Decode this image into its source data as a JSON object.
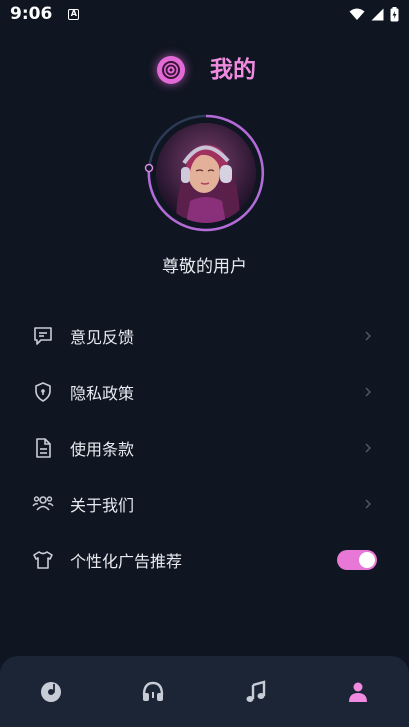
{
  "status_bar": {
    "time": "9:06",
    "notification_icon": "a-icon",
    "wifi_icon": "wifi-icon",
    "signal_icon": "signal-icon",
    "battery_icon": "battery-charging-icon"
  },
  "header": {
    "title": "我的",
    "logo_icon": "vinyl-record-icon"
  },
  "profile": {
    "avatar_icon": "avatar-headphones-girl",
    "username": "尊敬的用户"
  },
  "menu": {
    "items": [
      {
        "label": "意见反馈",
        "icon": "feedback-icon"
      },
      {
        "label": "隐私政策",
        "icon": "shield-icon"
      },
      {
        "label": "使用条款",
        "icon": "document-icon"
      },
      {
        "label": "关于我们",
        "icon": "people-icon"
      },
      {
        "label": "个性化广告推荐",
        "icon": "tshirt-icon",
        "toggle_on": true
      }
    ]
  },
  "bottom_nav": {
    "items": [
      {
        "icon": "disc-icon",
        "active": false
      },
      {
        "icon": "headphones-icon",
        "active": false
      },
      {
        "icon": "music-note-icon",
        "active": false
      },
      {
        "icon": "user-icon",
        "active": true
      }
    ]
  },
  "colors": {
    "background": "#0f1521",
    "accent": "#f08be0",
    "nav_background": "#1b2536",
    "icon_gray": "#c8ccd6"
  }
}
